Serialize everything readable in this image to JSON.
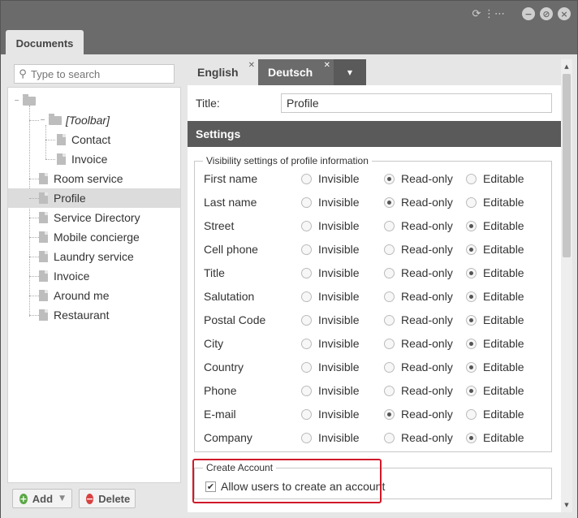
{
  "window": {
    "title_icons": [
      "refresh-icon",
      "sitemap-icon",
      "minimize-icon",
      "cancel-icon",
      "close-icon"
    ]
  },
  "tabs": {
    "documents": "Documents"
  },
  "search": {
    "placeholder": "Type to search"
  },
  "tree": {
    "items": [
      {
        "label": "",
        "type": "root"
      },
      {
        "label": "[Toolbar]",
        "type": "folder"
      },
      {
        "label": "Contact",
        "type": "page"
      },
      {
        "label": "Invoice",
        "type": "page"
      },
      {
        "label": "Room service",
        "type": "page"
      },
      {
        "label": "Profile",
        "type": "page",
        "selected": true
      },
      {
        "label": "Service Directory",
        "type": "page"
      },
      {
        "label": "Mobile concierge",
        "type": "page"
      },
      {
        "label": "Laundry service",
        "type": "page"
      },
      {
        "label": "Invoice",
        "type": "page"
      },
      {
        "label": "Around me",
        "type": "page"
      },
      {
        "label": "Restaurant",
        "type": "page"
      }
    ]
  },
  "buttons": {
    "add": "Add",
    "delete": "Delete"
  },
  "lang_tabs": [
    {
      "label": "English",
      "active": true
    },
    {
      "label": "Deutsch",
      "active": false
    }
  ],
  "form": {
    "title_label": "Title:",
    "title_value": "Profile",
    "settings_heading": "Settings"
  },
  "visibility": {
    "legend": "Visibility settings of profile information",
    "options": [
      "Invisible",
      "Read-only",
      "Editable"
    ],
    "rows": [
      {
        "label": "First name",
        "selected": "Read-only"
      },
      {
        "label": "Last name",
        "selected": "Read-only"
      },
      {
        "label": "Street",
        "selected": "Editable"
      },
      {
        "label": "Cell phone",
        "selected": "Editable"
      },
      {
        "label": "Title",
        "selected": "Editable"
      },
      {
        "label": "Salutation",
        "selected": "Editable"
      },
      {
        "label": "Postal Code",
        "selected": "Editable"
      },
      {
        "label": "City",
        "selected": "Editable"
      },
      {
        "label": "Country",
        "selected": "Editable"
      },
      {
        "label": "Phone",
        "selected": "Editable"
      },
      {
        "label": "E-mail",
        "selected": "Read-only"
      },
      {
        "label": "Company",
        "selected": "Editable"
      }
    ]
  },
  "account": {
    "legend": "Create Account",
    "checkbox_label": "Allow users to create an account",
    "checked": true
  },
  "colors": {
    "chrome": "#6b6b6b",
    "panel": "#e6e6e6",
    "header_bar": "#5a5a5a",
    "highlight": "#d0192a",
    "add_green": "#5aa745",
    "delete_red": "#d94141"
  }
}
